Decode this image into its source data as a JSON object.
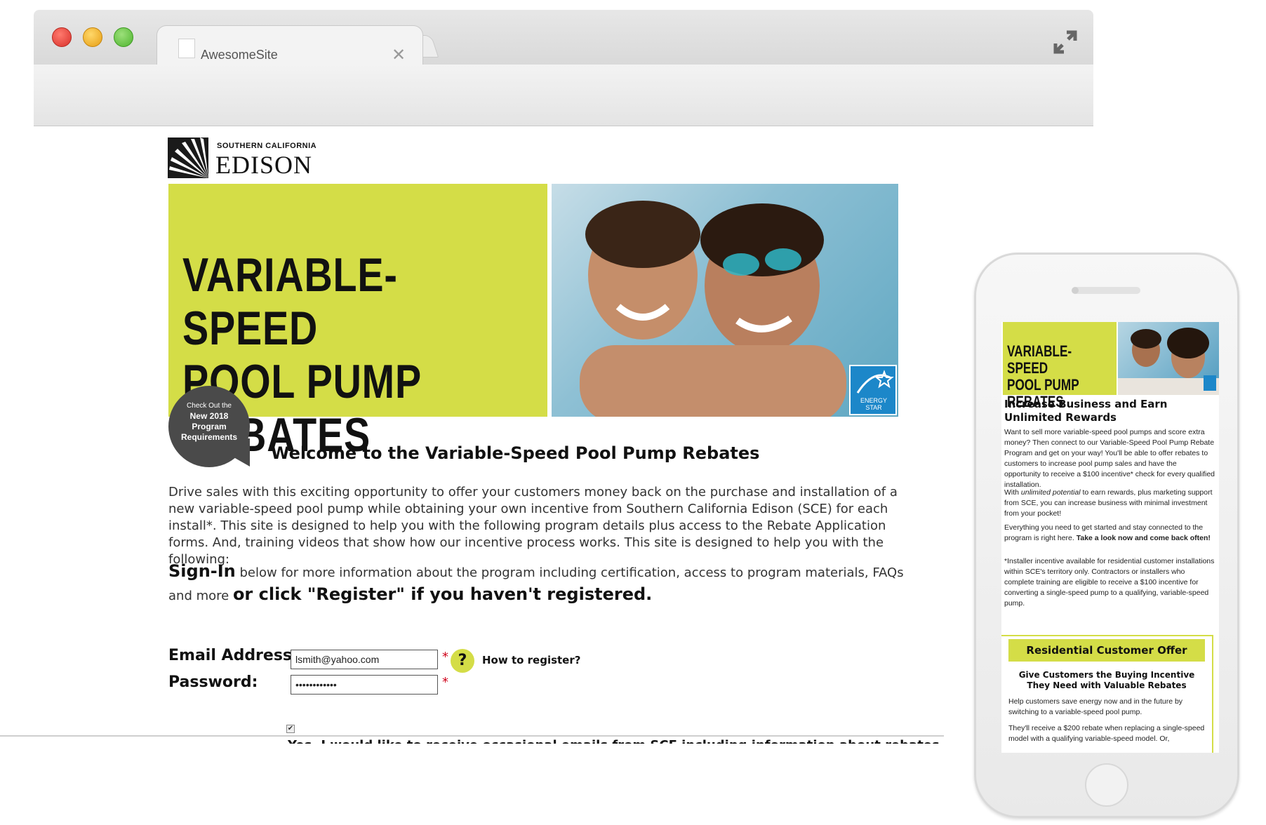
{
  "browser": {
    "tab_title": "AwesomeSite",
    "address_value": ""
  },
  "logo": {
    "line1": "SOUTHERN CALIFORNIA",
    "line2": "EDISON"
  },
  "hero": {
    "title_line1": "VARIABLE-SPEED",
    "title_line2": "POOL PUMP REBATES",
    "energy_star_label": "ENERGY STAR"
  },
  "badge": {
    "line1": "Check Out the",
    "line2": "New 2018",
    "line3": "Program",
    "line4": "Requirements"
  },
  "welcome": "Welcome to the Variable-Speed Pool Pump Rebates",
  "intro": "Drive sales with this exciting opportunity to offer your customers money back on the purchase and installation of a new variable-speed pool pump while obtaining your own incentive from Southern California Edison (SCE) for each install*. This site is designed to help you with the following program details plus access to the Rebate Application forms. And, training videos that show how our incentive process works. This site is designed to help you with the following:",
  "signin": {
    "lead": "Sign-In",
    "middle": " below for more information about the program including certification, access to program materials, FAQs and more ",
    "tail": "or click \"Register\" if you haven't registered."
  },
  "form": {
    "email_label": "Email Address:",
    "email_value": "lsmith@yahoo.com",
    "password_label": "Password:",
    "password_value": "••••••••••••",
    "required_mark": "*",
    "help_symbol": "?",
    "help_link": "How to register?",
    "optin_check": "✔",
    "optin_text": "Yes, I would like to receive occasional emails from SCE including information about rebates."
  },
  "mobile": {
    "hero_line1": "VARIABLE-SPEED",
    "hero_line2": "POOL PUMP REBATES",
    "heading": "Increase Business and Earn Unlimited Rewards",
    "para1": "Want to sell more variable-speed pool pumps and score extra money? Then connect to our Variable-Speed Pool Pump Rebate Program and get on your way! You'll be able to offer rebates to customers to increase pool pump sales and have the opportunity to receive a $100 incentive* check for every qualified installation.",
    "para2_italic": "unlimited potential",
    "para2_pre": "With ",
    "para2_post": " to earn rewards, plus marketing support from SCE, you can increase business with minimal investment from your pocket!",
    "para3_pre": "Everything you need to get started and stay connected to the program is right here. ",
    "para3_bold": "Take a look now and come back often!",
    "para4": "*Installer incentive available for residential customer installations within SCE's territory only. Contractors or installers who complete training are eligible to receive a $100 incentive for converting a single-speed pump to a qualifying, variable-speed pump.",
    "offer_title": "Residential Customer Offer",
    "offer_sub": "Give Customers the Buying Incentive They Need with Valuable Rebates",
    "offer_p1": "Help customers save energy now and in the future by switching to a variable-speed pool pump.",
    "offer_p2": "They'll receive a $200 rebate when replacing a single-speed model with a qualifying variable-speed model. Or,"
  },
  "colors": {
    "accent_lime": "#d4dd47",
    "dark_badge": "#4a4a4a",
    "required_red": "#d0021b"
  }
}
